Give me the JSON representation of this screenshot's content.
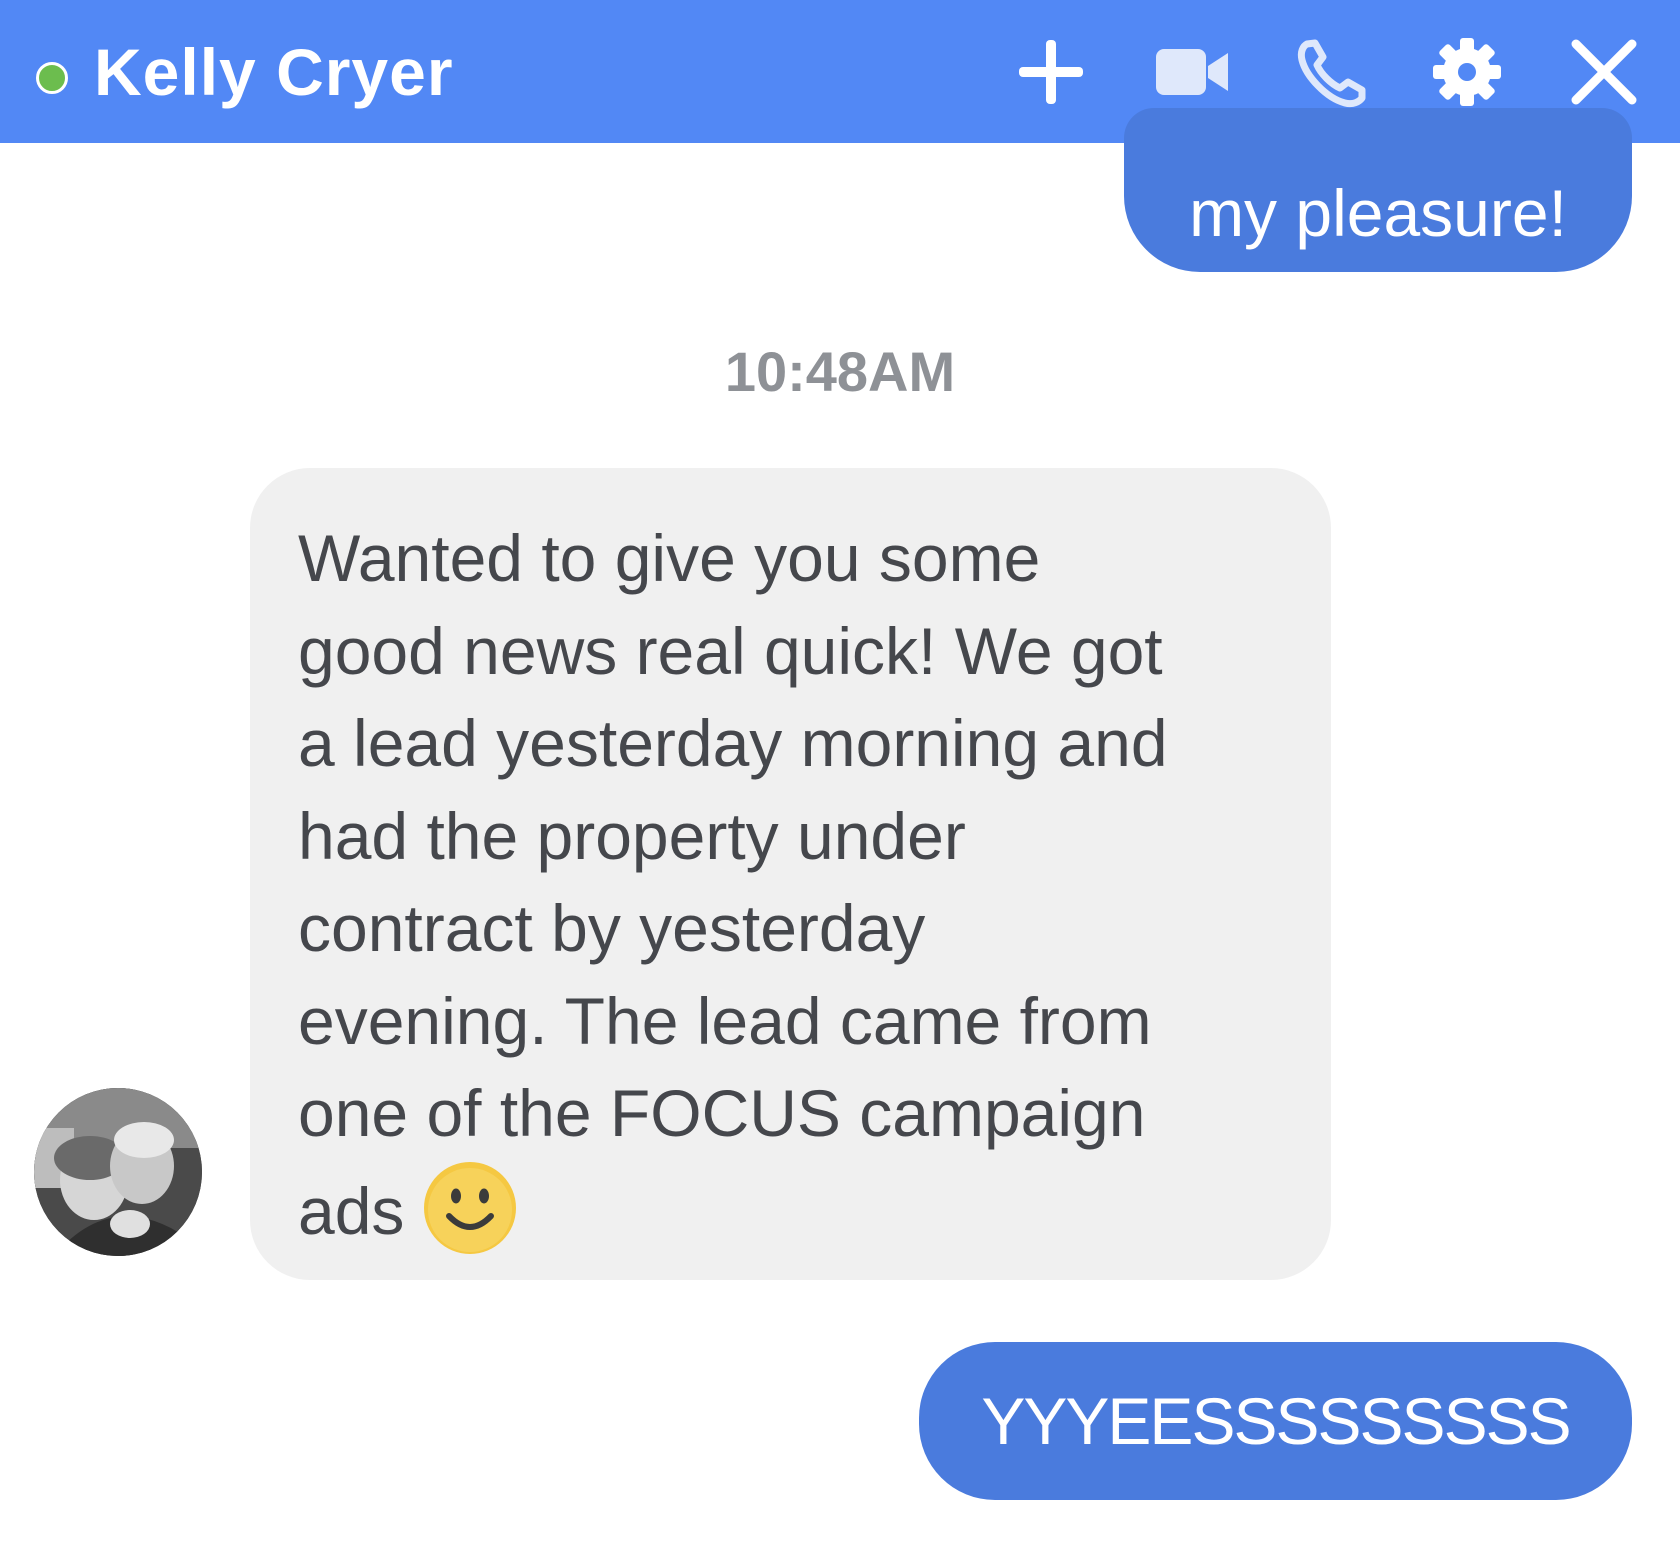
{
  "header": {
    "contact_name": "Kelly Cryer",
    "presence": "online",
    "background_color": "#5288f5",
    "presence_color": "#6cbd4e",
    "icons": [
      "add-icon",
      "video-camera-icon",
      "phone-icon",
      "gear-icon",
      "close-icon"
    ]
  },
  "messages": {
    "outgoing_1": "my pleasure!",
    "timestamp": "10:48AM",
    "incoming_lines": [
      "Wanted to give you some",
      "good news real quick! We got",
      "a lead yesterday morning and",
      "had the property under",
      "contract by yesterday",
      "evening. The lead came from",
      "one of the FOCUS campaign",
      "ads"
    ],
    "incoming_emoji": "smiley-emoji",
    "outgoing_2": "YYYEESSSSSSSSS",
    "outgoing_color": "#4a7bdd",
    "incoming_color": "#f0f0f0"
  }
}
